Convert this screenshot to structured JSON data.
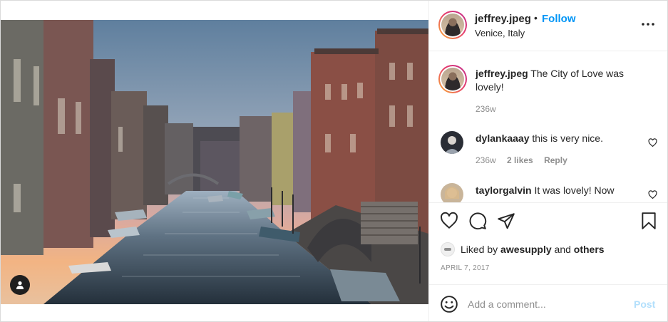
{
  "post": {
    "username": "jeffrey.jpeg",
    "separator": "•",
    "follow_label": "Follow",
    "location": "Venice, Italy",
    "more_icon": "more-horizontal-icon"
  },
  "comments": [
    {
      "username": "jeffrey.jpeg",
      "text": " The City of Love was lovely!",
      "time": "236w"
    },
    {
      "username": "dylankaaay",
      "text": " this is very nice.",
      "time": "236w",
      "likes": "2 likes",
      "reply": "Reply"
    },
    {
      "username": "taylorgalvin",
      "text": " It was lovely! Now"
    }
  ],
  "actions": {
    "icons": [
      "heart-icon",
      "comment-icon",
      "share-icon",
      "bookmark-icon"
    ]
  },
  "likes": {
    "prefix": "Liked by ",
    "user": "awesupply",
    "middle": " and ",
    "others": "others"
  },
  "date": "APRIL 7, 2017",
  "add_comment": {
    "placeholder": "Add a comment...",
    "post_label": "Post"
  },
  "colors": {
    "accent": "#0095f6",
    "post_disabled": "#b2dffc",
    "muted": "#8e8e8e"
  }
}
